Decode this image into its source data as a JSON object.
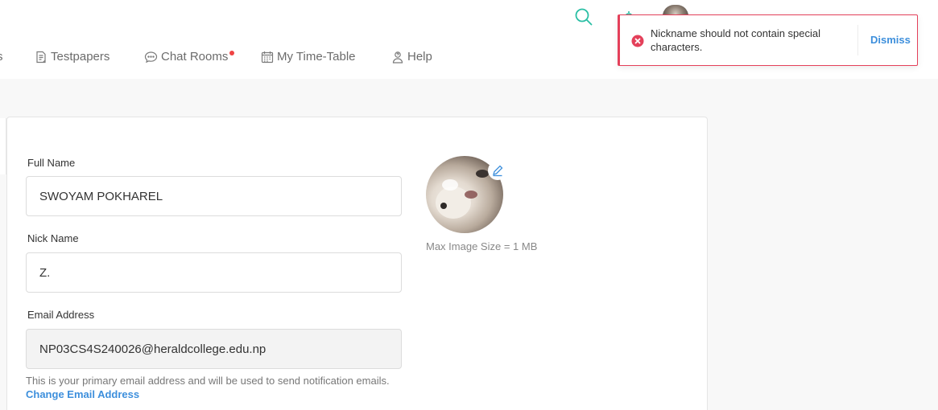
{
  "nav": {
    "items": [
      {
        "label": "s"
      },
      {
        "label": "Testpapers"
      },
      {
        "label": "Chat Rooms"
      },
      {
        "label": "My Time-Table"
      },
      {
        "label": "Help"
      }
    ]
  },
  "colors": {
    "accent": "#3d8fdc",
    "search_icon": "#2bbfa5",
    "error": "#e4405a",
    "notification_dot": "#ef4444"
  },
  "toast": {
    "message": "Nickname should not contain special characters.",
    "dismiss_label": "Dismiss",
    "icon": "error-circle-icon"
  },
  "form": {
    "full_name": {
      "label": "Full Name",
      "value": "SWOYAM POKHAREL"
    },
    "nick_name": {
      "label": "Nick Name",
      "value": "Z."
    },
    "email": {
      "label": "Email Address",
      "value": "NP03CS4S240026@heraldcollege.edu.np"
    },
    "email_help": "This is your primary email address and will be used to send notification emails.",
    "change_email_label": "Change Email Address"
  },
  "profile": {
    "max_image_size": "Max Image Size = 1 MB"
  }
}
